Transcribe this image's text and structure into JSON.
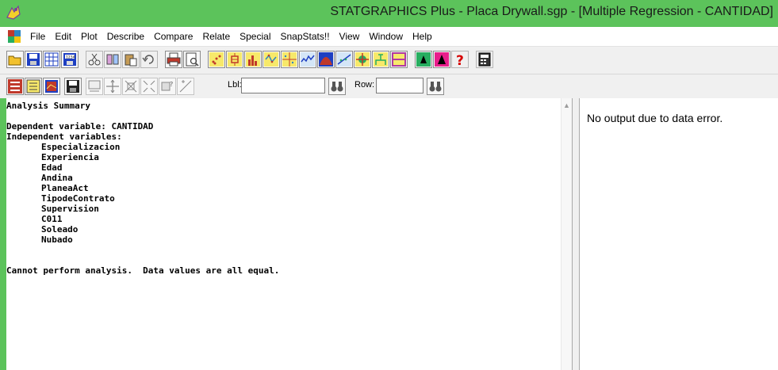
{
  "window": {
    "title": "STATGRAPHICS Plus - Placa Drywall.sgp - [Multiple Regression - CANTIDAD]",
    "frame_color": "#5cc35b"
  },
  "menu": {
    "items": [
      "File",
      "Edit",
      "Plot",
      "Describe",
      "Compare",
      "Relate",
      "Special",
      "SnapStats!!",
      "View",
      "Window",
      "Help"
    ]
  },
  "toolbar": {
    "lbl_label": "Lbl:",
    "lbl_value": "",
    "row_label": "Row:",
    "row_value": "",
    "icons": [
      "open-icon",
      "save-icon",
      "datasheet-icon",
      "data-numbers-icon",
      "cut-icon",
      "copy-icon",
      "paste-icon",
      "undo-icon",
      "print-icon",
      "print-preview-icon",
      "scatterplot-icon",
      "box-plot-icon",
      "bar-chart-icon",
      "xbar-chart-icon",
      "scatter-matrix-icon",
      "time-series-icon",
      "distribution-icon",
      "regression-icon",
      "crosshair-icon",
      "tree-icon",
      "snapstat-icon",
      "run-icon",
      "stop-icon",
      "help-icon",
      "calculator-icon"
    ]
  },
  "analysis": {
    "heading": "Analysis Summary",
    "dependent_line": "Dependent variable: CANTIDAD",
    "independent_heading": "Independent variables:",
    "independent_vars": [
      "Especializacion",
      "Experiencia",
      "Edad",
      "Andina",
      "PlaneaAct",
      "TipodeContrato",
      "Supervision",
      "C011",
      "Soleado",
      "Nubado"
    ],
    "error_message": "Cannot perform analysis.  Data values are all equal."
  },
  "right_pane": {
    "message": "No output due to data error."
  }
}
